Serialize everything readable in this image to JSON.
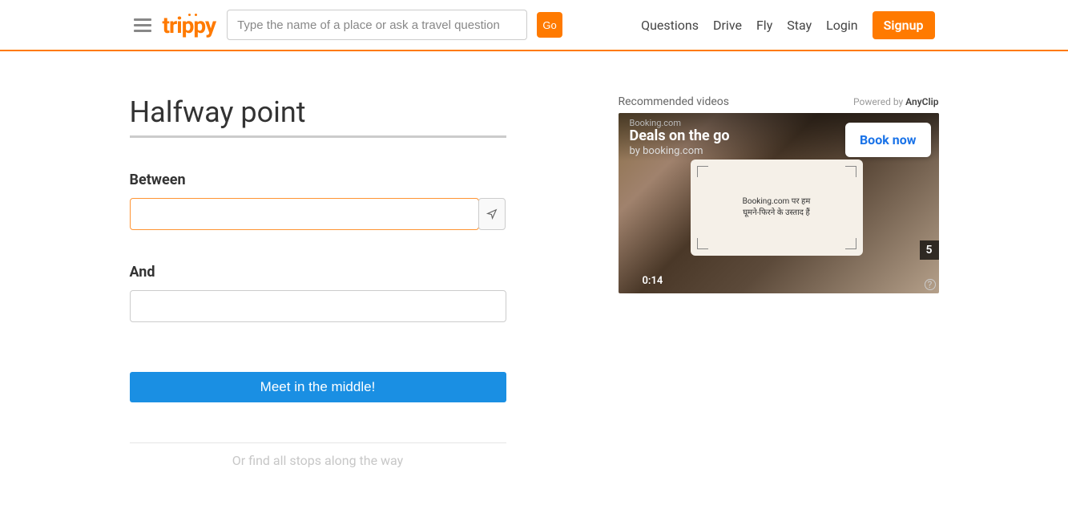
{
  "header": {
    "logo": "trippy",
    "search_placeholder": "Type the name of a place or ask a travel question",
    "go_label": "Go",
    "nav": {
      "questions": "Questions",
      "drive": "Drive",
      "fly": "Fly",
      "stay": "Stay",
      "login": "Login",
      "signup": "Signup"
    }
  },
  "main": {
    "title": "Halfway point",
    "between_label": "Between",
    "and_label": "And",
    "submit_label": "Meet in the middle!",
    "find_stops_label": "Or find all stops along the way"
  },
  "sidebar": {
    "recommended_label": "Recommended videos",
    "powered_by_prefix": "Powered by ",
    "powered_by_brand": "AnyClip",
    "video": {
      "booking_label": "Booking.com",
      "title": "Deals on the go",
      "subtitle": "by booking.com",
      "book_now": "Book now",
      "frame_text_1": "Booking.com पर हम",
      "frame_text_2": "घूमने-फिरने के उस्ताद हैं",
      "time": "0:14",
      "count": "5",
      "help": "?"
    }
  }
}
